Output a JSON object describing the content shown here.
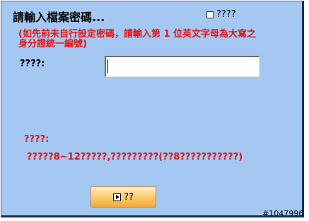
{
  "dialog": {
    "title": "請輸入檔案密碼...",
    "remember_label": "????",
    "hint": "(如先前未自行設定密碼，請輸入第 1 位英文字母為大寫之身分證統一編號)",
    "password_label": "????:",
    "password_value": "",
    "note_label": "????:",
    "note_text": "?????8~12?????,?????????(??8???????????)",
    "submit_label": "??"
  },
  "watermark": "#1047996",
  "colors": {
    "background": "#a4c8f2",
    "warning_text": "#e11414",
    "button_gradient": "#ffc766"
  },
  "icons": {
    "submit": "play-icon"
  }
}
